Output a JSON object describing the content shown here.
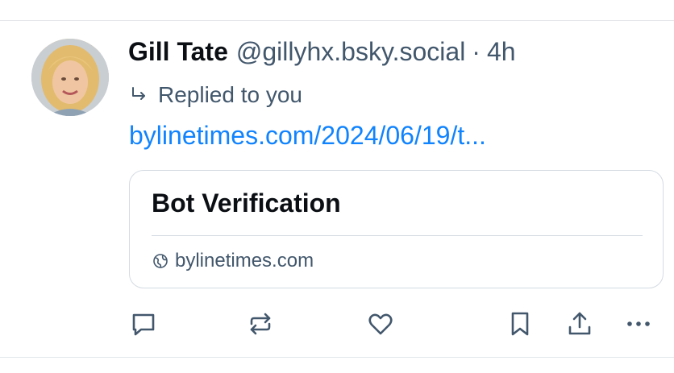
{
  "post": {
    "author": {
      "display_name": "Gill Tate",
      "handle": "@gillyhx.bsky.social"
    },
    "separator": "·",
    "time_ago": "4h",
    "reply_context": "Replied to you",
    "link_text": "bylinetimes.com/2024/06/19/t...",
    "embed": {
      "title": "Bot Verification",
      "domain": "bylinetimes.com"
    }
  },
  "actions": [
    {
      "name": "reply-icon"
    },
    {
      "name": "repost-icon"
    },
    {
      "name": "like-icon"
    },
    {
      "name": "bookmark-icon"
    },
    {
      "name": "share-icon"
    },
    {
      "name": "more-icon"
    }
  ],
  "colors": {
    "text_primary": "#0b0f14",
    "text_secondary": "#42576c",
    "link": "#1083fe",
    "border": "#d4dbe2",
    "icon": "#42576c"
  }
}
